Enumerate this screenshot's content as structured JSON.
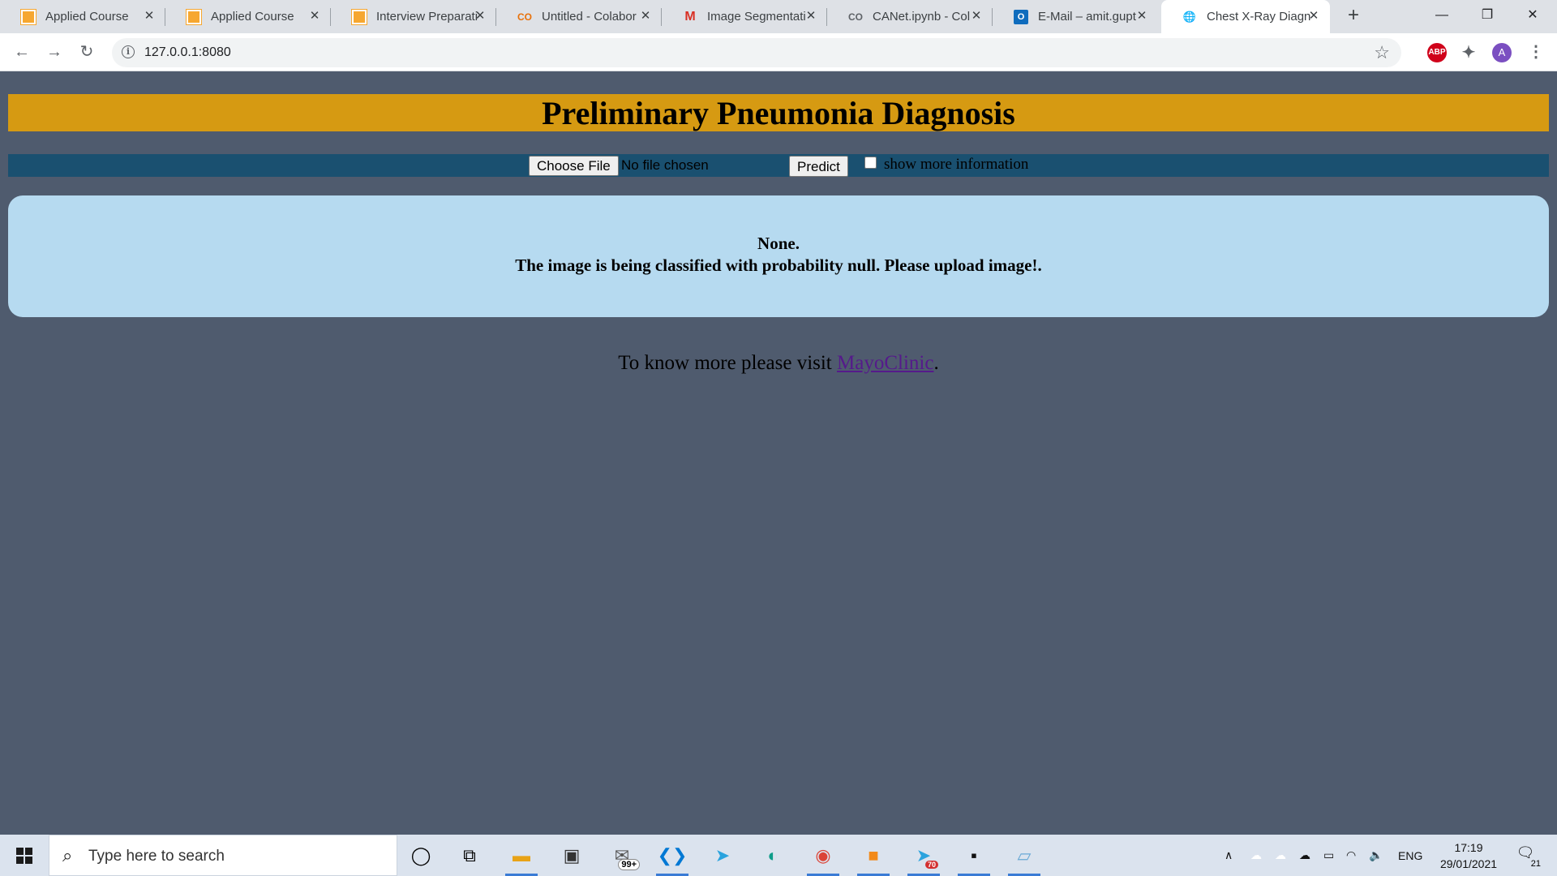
{
  "browser": {
    "tabs": [
      {
        "title": "Applied Course",
        "favicon": "applied-course-icon"
      },
      {
        "title": "Applied Course",
        "favicon": "applied-course-icon"
      },
      {
        "title": "Interview Preparati",
        "favicon": "applied-course-icon"
      },
      {
        "title": "Untitled - Colabor",
        "favicon": "colab-icon"
      },
      {
        "title": "Image Segmentati",
        "favicon": "gmail-icon"
      },
      {
        "title": "CANet.ipynb - Col",
        "favicon": "colab-icon"
      },
      {
        "title": "E-Mail – amit.gupt",
        "favicon": "outlook-icon"
      },
      {
        "title": "Chest X-Ray Diagn",
        "favicon": "globe-icon",
        "active": true
      }
    ],
    "url": "127.0.0.1:8080",
    "profile_initial": "A",
    "abp_label": "ABP"
  },
  "page": {
    "title": "Preliminary Pneumonia Diagnosis",
    "form": {
      "file_button_label": "Choose File",
      "file_status": "No file chosen",
      "predict_label": "Predict",
      "checkbox_label": "show more information",
      "checkbox_checked": false
    },
    "result": {
      "line1": "None.",
      "line2": "The image is being classified with probability null. Please upload image!."
    },
    "more_info": {
      "prefix": "To know more please visit ",
      "link_text": "MayoClinic",
      "suffix": "."
    }
  },
  "colors": {
    "page_bg": "#4f5b6e",
    "banner_bg": "#d69a12",
    "formbar_bg": "#1a5070",
    "result_bg": "#b6daf0",
    "link": "#551a8b"
  },
  "taskbar": {
    "search_placeholder": "Type here to search",
    "mail_badge": "99+",
    "telegram_badge": "70",
    "language": "ENG",
    "time": "17:19",
    "date": "29/01/2021",
    "notification_count": "21"
  }
}
